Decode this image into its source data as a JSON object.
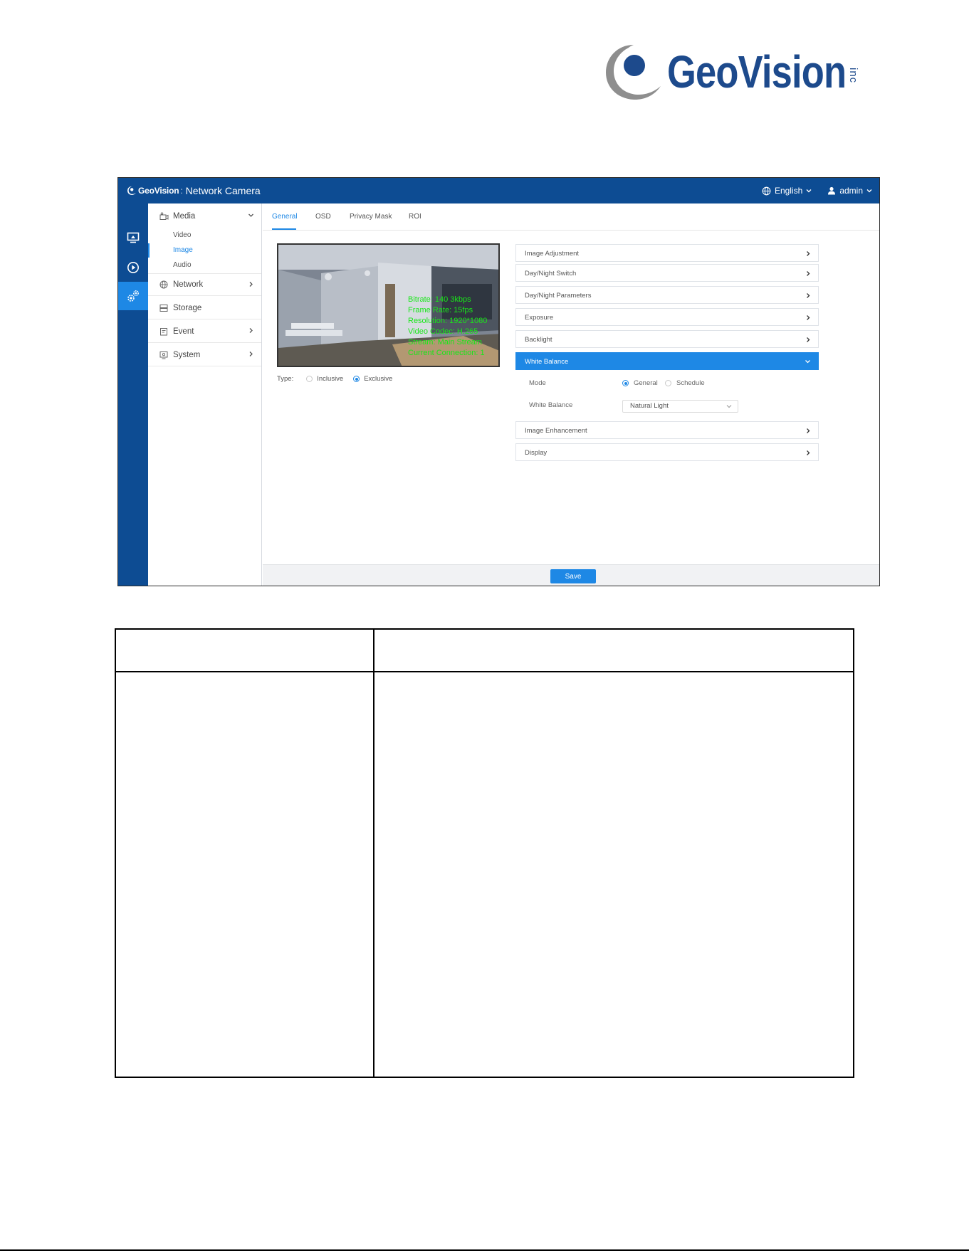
{
  "brand": {
    "logo_text": "GeoVision",
    "logo_suffix": "inc",
    "colors": {
      "primary": "#1d4a8c",
      "swoosh": "#8e8e8e"
    }
  },
  "app": {
    "header": {
      "brand_text": "GeoVision",
      "separator": ":",
      "title": "Network Camera",
      "language": "English",
      "user": "admin"
    },
    "rail": [
      {
        "icon": "live-view-icon"
      },
      {
        "icon": "playback-icon"
      },
      {
        "icon": "settings-icon",
        "active": true
      }
    ],
    "sidebar": {
      "items": [
        {
          "label": "Media",
          "icon": "camera-icon",
          "expanded": true
        },
        {
          "label": "Network",
          "icon": "globe-icon"
        },
        {
          "label": "Storage",
          "icon": "storage-icon"
        },
        {
          "label": "Event",
          "icon": "event-icon"
        },
        {
          "label": "System",
          "icon": "system-icon"
        }
      ],
      "sub_items": [
        {
          "label": "Video"
        },
        {
          "label": "Image",
          "active": true
        },
        {
          "label": "Audio"
        }
      ]
    },
    "tabs": [
      {
        "label": "General",
        "active": true
      },
      {
        "label": "OSD"
      },
      {
        "label": "Privacy Mask"
      },
      {
        "label": "ROI"
      }
    ],
    "preview": {
      "osd_lines": [
        "Bitrate: 140 3kbps",
        "Frame Rate: 15fps",
        "Resolution: 1920*1080",
        "Video Codec: H.265",
        "Stream: Main Stream",
        "Current Connection: 1"
      ],
      "type_label": "Type:",
      "type_options": [
        "Inclusive",
        "Exclusive"
      ],
      "type_selected": "Exclusive"
    },
    "panels": [
      {
        "label": "Image Adjustment"
      },
      {
        "label": "Day/Night Switch"
      },
      {
        "label": "Day/Night Parameters"
      },
      {
        "label": "Exposure"
      },
      {
        "label": "Backlight"
      },
      {
        "label": "White Balance",
        "open": true
      },
      {
        "label": "Image Enhancement"
      },
      {
        "label": "Display"
      }
    ],
    "white_balance": {
      "mode_label": "Mode",
      "mode_options": [
        "General",
        "Schedule"
      ],
      "mode_selected": "General",
      "wb_label": "White Balance",
      "wb_value": "Natural Light"
    },
    "save_label": "Save",
    "colors": {
      "header": "#0d4c93",
      "accent": "#1e88e5",
      "osd": "#19e619"
    }
  }
}
